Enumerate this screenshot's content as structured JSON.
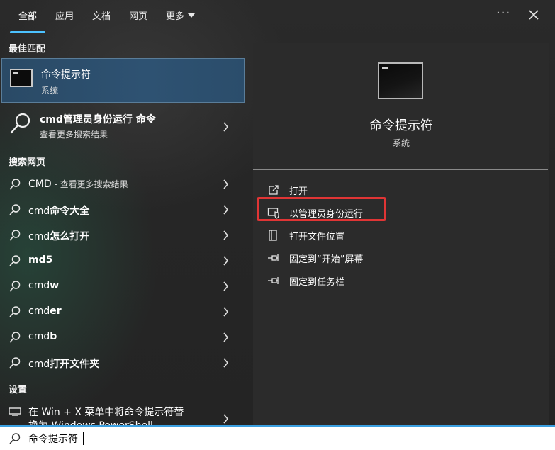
{
  "tabs": [
    {
      "label": "全部"
    },
    {
      "label": "应用"
    },
    {
      "label": "文档"
    },
    {
      "label": "网页"
    },
    {
      "label": "更多"
    }
  ],
  "topbar": {
    "ellipsis": "···"
  },
  "sections": {
    "best_match": "最佳匹配",
    "search_web": "搜索网页",
    "settings": "设置"
  },
  "best_match": {
    "title": "命令提示符",
    "subtitle": "系统"
  },
  "web_top": {
    "title": "cmd管理员身份运行 命令",
    "subtitle": "查看更多搜索结果"
  },
  "web_results": [
    {
      "prefix": "CMD",
      "bold": "",
      "suffix": " - 查看更多搜索结果"
    },
    {
      "prefix": "cmd",
      "bold": "命令大全",
      "suffix": ""
    },
    {
      "prefix": "cmd",
      "bold": "怎么打开",
      "suffix": ""
    },
    {
      "prefix": "",
      "bold": "md5",
      "suffix": ""
    },
    {
      "prefix": "cmd",
      "bold": "w",
      "suffix": ""
    },
    {
      "prefix": "cmd",
      "bold": "er",
      "suffix": ""
    },
    {
      "prefix": "cmd",
      "bold": "b",
      "suffix": ""
    },
    {
      "prefix": "cmd",
      "bold": "打开文件夹",
      "suffix": ""
    }
  ],
  "settings_item": {
    "line1": "在 Win + X 菜单中将命令提示符替",
    "line2": "换为 Windows PowerShell"
  },
  "preview": {
    "name": "命令提示符",
    "type": "系统"
  },
  "actions": [
    {
      "label": "打开",
      "icon": "open-icon"
    },
    {
      "label": "以管理员身份运行",
      "icon": "shield-icon"
    },
    {
      "label": "打开文件位置",
      "icon": "file-location-icon"
    },
    {
      "label": "固定到“开始”屏幕",
      "icon": "pin-icon"
    },
    {
      "label": "固定到任务栏",
      "icon": "pin-icon"
    }
  ],
  "search": {
    "value": "命令提示符"
  },
  "colors": {
    "accent": "#4cc2ff",
    "highlight": "#e03535",
    "selected_bg": "#2e5272"
  }
}
